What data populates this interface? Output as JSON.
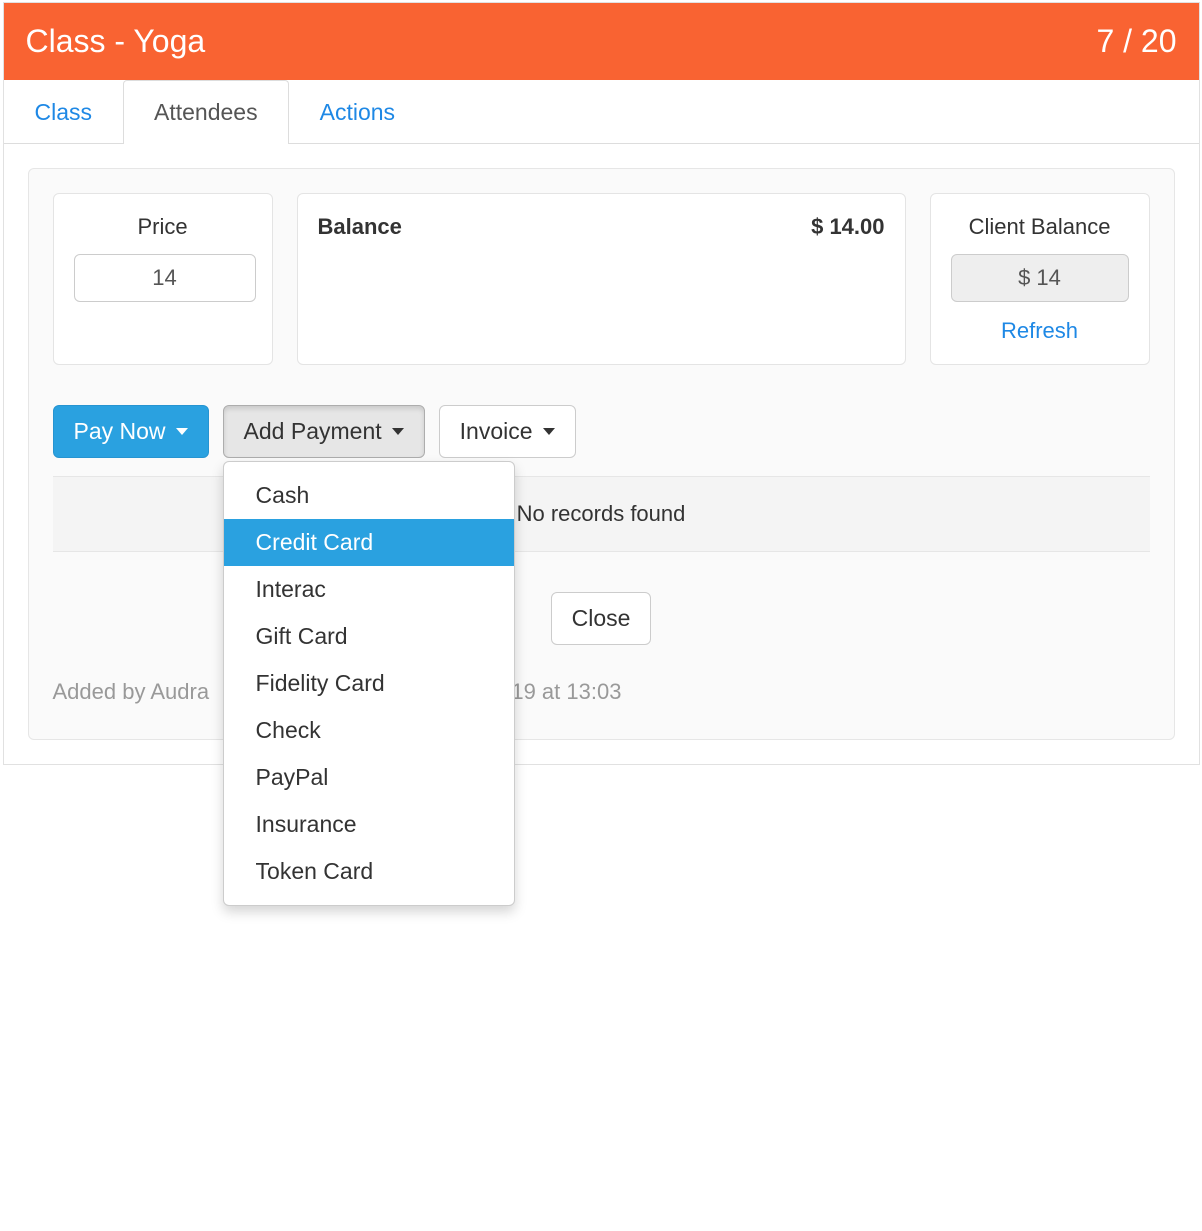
{
  "header": {
    "title": "Class - Yoga",
    "count": "7 / 20"
  },
  "tabs": {
    "class": "Class",
    "attendees": "Attendees",
    "actions": "Actions"
  },
  "price": {
    "label": "Price",
    "value": "14"
  },
  "balance": {
    "label": "Balance",
    "amount": "$ 14.00"
  },
  "client_balance": {
    "label": "Client Balance",
    "value": "$ 14",
    "refresh": "Refresh"
  },
  "buttons": {
    "pay_now": "Pay Now",
    "add_payment": "Add Payment",
    "invoice": "Invoice",
    "close": "Close"
  },
  "payment_options": [
    "Cash",
    "Credit Card",
    "Interac",
    "Gift Card",
    "Fidelity Card",
    "Check",
    "PayPal",
    "Insurance",
    "Token Card"
  ],
  "highlighted_option_index": 1,
  "no_records": "No records found",
  "footer": {
    "text_prefix": "Added by Audra",
    "text_suffix": "19 at 13:03"
  }
}
